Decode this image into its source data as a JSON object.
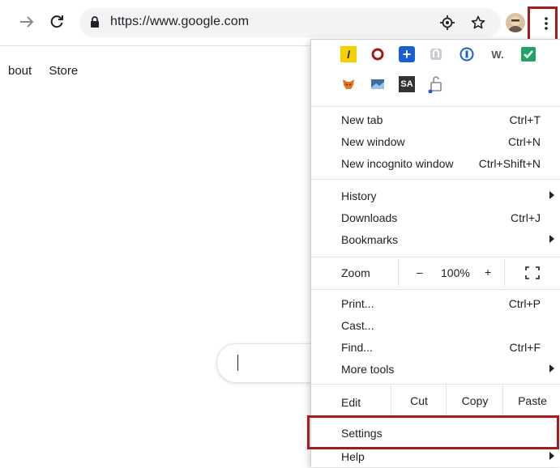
{
  "browser": {
    "url": "https://www.google.com",
    "icons": [
      "back-arrow-icon",
      "reload-icon",
      "lock-icon",
      "location-target-icon",
      "star-icon",
      "profile-avatar",
      "three-dots-menu-icon"
    ]
  },
  "page": {
    "links": [
      "bout",
      "Store"
    ]
  },
  "menu": {
    "extensions_row1": [
      {
        "name": "norton-l-icon",
        "text": "l",
        "color": "#f5d000"
      },
      {
        "name": "opera-o-icon",
        "text": "o",
        "color": "#9e1b1b"
      },
      {
        "name": "plus-blue-icon",
        "text": "+",
        "color": "#1a5fd1"
      },
      {
        "name": "ghost-icon",
        "text": "",
        "color": "#b9bec4"
      },
      {
        "name": "onepassword-icon",
        "text": "",
        "color": "#1a5fd1"
      },
      {
        "name": "w-icon",
        "text": "W.",
        "color": "#555555"
      },
      {
        "name": "green-check-icon",
        "text": "",
        "color": "#1fa463"
      }
    ],
    "extensions_row2": [
      {
        "name": "metamask-fox-icon",
        "text": "",
        "color": "#e2761b"
      },
      {
        "name": "image-extension-icon",
        "text": "",
        "color": "#3a6fa3"
      },
      {
        "name": "sa-extension-icon",
        "text": "SA",
        "color": "#333333"
      },
      {
        "name": "unlock-extension-icon",
        "text": "",
        "color": "#888888"
      }
    ],
    "group1": [
      {
        "label": "New tab",
        "shortcut": "Ctrl+T"
      },
      {
        "label": "New window",
        "shortcut": "Ctrl+N"
      },
      {
        "label": "New incognito window",
        "shortcut": "Ctrl+Shift+N"
      }
    ],
    "group2": [
      {
        "label": "History",
        "shortcut": "",
        "submenu": true
      },
      {
        "label": "Downloads",
        "shortcut": "Ctrl+J",
        "submenu": false
      },
      {
        "label": "Bookmarks",
        "shortcut": "",
        "submenu": true
      }
    ],
    "zoom": {
      "label": "Zoom",
      "minus": "–",
      "value": "100%",
      "plus": "+"
    },
    "group3": [
      {
        "label": "Print...",
        "shortcut": "Ctrl+P",
        "submenu": false
      },
      {
        "label": "Cast...",
        "shortcut": "",
        "submenu": false
      },
      {
        "label": "Find...",
        "shortcut": "Ctrl+F",
        "submenu": false
      },
      {
        "label": "More tools",
        "shortcut": "",
        "submenu": true
      }
    ],
    "edit": {
      "label": "Edit",
      "cut": "Cut",
      "copy": "Copy",
      "paste": "Paste"
    },
    "settings": {
      "label": "Settings"
    },
    "help": {
      "label": "Help"
    }
  },
  "highlight_color": "#a31d1d"
}
